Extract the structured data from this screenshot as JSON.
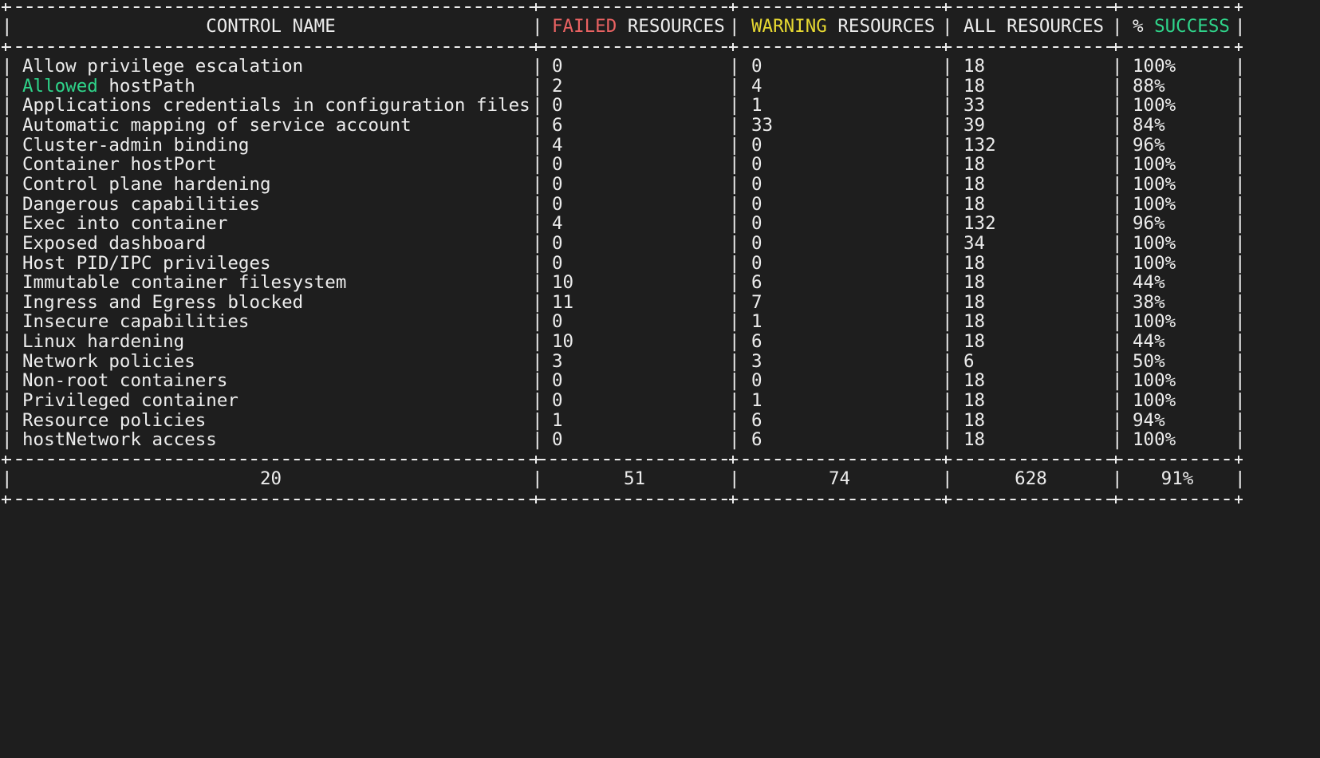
{
  "header": {
    "control_name": "CONTROL NAME",
    "failed_word": "FAILED",
    "failed_rest": " RESOURCES",
    "warning_word": "WARNING",
    "warning_rest": " RESOURCES",
    "all_resources": "ALL RESOURCES",
    "success_prefix": "% ",
    "success_word": "SUCCESS"
  },
  "colors": {
    "background": "#1e1e1e",
    "text": "#ececec",
    "failed": "#e96262",
    "warning": "#e6d832",
    "success": "#2fd48a"
  },
  "rows": [
    {
      "name": "Allow privilege escalation",
      "failed": "0",
      "warning": "0",
      "all": "18",
      "success": "100%"
    },
    {
      "name_highlight": "Allowed",
      "name_rest": " hostPath",
      "name": "Allowed hostPath",
      "failed": "2",
      "warning": "4",
      "all": "18",
      "success": "88%"
    },
    {
      "name": "Applications credentials in configuration files",
      "failed": "0",
      "warning": "1",
      "all": "33",
      "success": "100%"
    },
    {
      "name": "Automatic mapping of service account",
      "failed": "6",
      "warning": "33",
      "all": "39",
      "success": "84%"
    },
    {
      "name": "Cluster-admin binding",
      "failed": "4",
      "warning": "0",
      "all": "132",
      "success": "96%"
    },
    {
      "name": "Container hostPort",
      "failed": "0",
      "warning": "0",
      "all": "18",
      "success": "100%"
    },
    {
      "name": "Control plane hardening",
      "failed": "0",
      "warning": "0",
      "all": "18",
      "success": "100%"
    },
    {
      "name": "Dangerous capabilities",
      "failed": "0",
      "warning": "0",
      "all": "18",
      "success": "100%"
    },
    {
      "name": "Exec into container",
      "failed": "4",
      "warning": "0",
      "all": "132",
      "success": "96%"
    },
    {
      "name": "Exposed dashboard",
      "failed": "0",
      "warning": "0",
      "all": "34",
      "success": "100%"
    },
    {
      "name": "Host PID/IPC privileges",
      "failed": "0",
      "warning": "0",
      "all": "18",
      "success": "100%"
    },
    {
      "name": "Immutable container filesystem",
      "failed": "10",
      "warning": "6",
      "all": "18",
      "success": "44%"
    },
    {
      "name": "Ingress and Egress blocked",
      "failed": "11",
      "warning": "7",
      "all": "18",
      "success": "38%"
    },
    {
      "name": "Insecure capabilities",
      "failed": "0",
      "warning": "1",
      "all": "18",
      "success": "100%"
    },
    {
      "name": "Linux hardening",
      "failed": "10",
      "warning": "6",
      "all": "18",
      "success": "44%"
    },
    {
      "name": "Network policies",
      "failed": "3",
      "warning": "3",
      "all": "6",
      "success": "50%"
    },
    {
      "name": "Non-root containers",
      "failed": "0",
      "warning": "0",
      "all": "18",
      "success": "100%"
    },
    {
      "name": "Privileged container",
      "failed": "0",
      "warning": "1",
      "all": "18",
      "success": "100%"
    },
    {
      "name": "Resource policies",
      "failed": "1",
      "warning": "6",
      "all": "18",
      "success": "94%"
    },
    {
      "name": "hostNetwork access",
      "failed": "0",
      "warning": "6",
      "all": "18",
      "success": "100%"
    }
  ],
  "totals": {
    "controls": "20",
    "failed": "51",
    "warning": "74",
    "all": "628",
    "success": "91%"
  }
}
